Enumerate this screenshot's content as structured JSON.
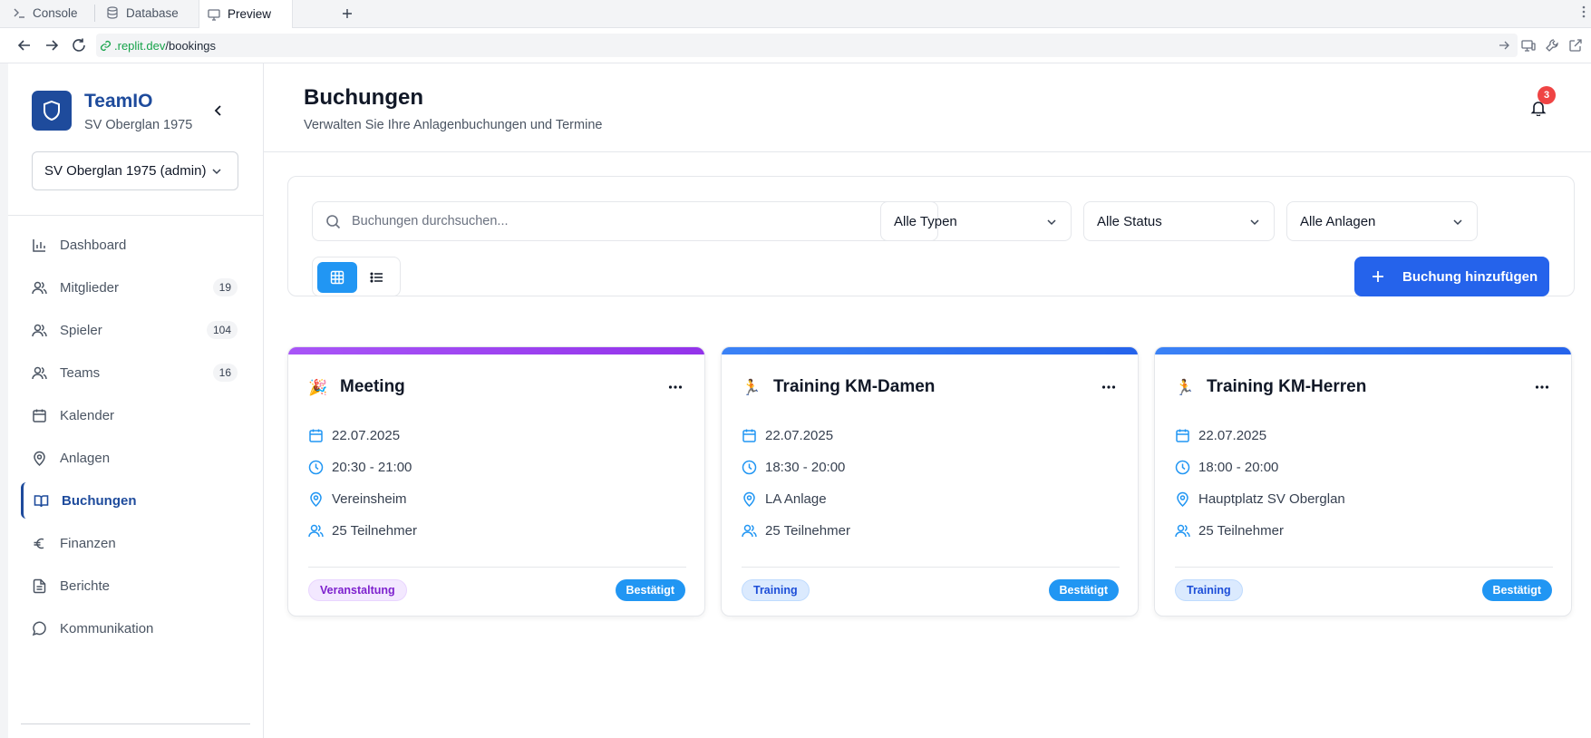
{
  "browser": {
    "tabs": [
      {
        "label": "Console",
        "icon": "terminal-icon"
      },
      {
        "label": "Database",
        "icon": "database-icon"
      },
      {
        "label": "Preview",
        "icon": "monitor-icon"
      }
    ],
    "url_host": ".replit.dev",
    "url_path": "/bookings"
  },
  "sidebar": {
    "brand_name": "TeamIO",
    "brand_sub": "SV Oberglan 1975",
    "club_select": "SV Oberglan 1975 (admin)",
    "items": [
      {
        "label": "Dashboard",
        "icon": "bar-chart-icon",
        "count": ""
      },
      {
        "label": "Mitglieder",
        "icon": "users-icon",
        "count": "19"
      },
      {
        "label": "Spieler",
        "icon": "users-icon",
        "count": "104"
      },
      {
        "label": "Teams",
        "icon": "users-icon",
        "count": "16"
      },
      {
        "label": "Kalender",
        "icon": "calendar-icon",
        "count": ""
      },
      {
        "label": "Anlagen",
        "icon": "map-pin-icon",
        "count": ""
      },
      {
        "label": "Buchungen",
        "icon": "book-open-icon",
        "count": "",
        "active": true
      },
      {
        "label": "Finanzen",
        "icon": "euro-icon",
        "count": ""
      },
      {
        "label": "Berichte",
        "icon": "file-text-icon",
        "count": ""
      },
      {
        "label": "Kommunikation",
        "icon": "message-icon",
        "count": ""
      }
    ]
  },
  "header": {
    "title": "Buchungen",
    "subtitle": "Verwalten Sie Ihre Anlagenbuchungen und Termine",
    "notifications_count": "3"
  },
  "filters": {
    "search_placeholder": "Buchungen durchsuchen...",
    "type_select": "Alle Typen",
    "status_select": "Alle Status",
    "facility_select": "Alle Anlagen",
    "add_button": "Buchung hinzufügen"
  },
  "colors": {
    "brand": "#1e4b9c",
    "accent": "#2196f3",
    "primary_button": "#2563eb",
    "event_bar": "#9333ea",
    "training_bar": "#2563eb",
    "badge_red": "#ef4444"
  },
  "bookings": [
    {
      "emoji": "🎉",
      "title": "Meeting",
      "date": "22.07.2025",
      "time": "20:30 - 21:00",
      "location": "Vereinsheim",
      "participants": "25 Teilnehmer",
      "type": "Veranstaltung",
      "status": "Bestätigt"
    },
    {
      "emoji": "🏃",
      "title": "Training KM-Damen",
      "date": "22.07.2025",
      "time": "18:30 - 20:00",
      "location": "LA Anlage",
      "participants": "25 Teilnehmer",
      "type": "Training",
      "status": "Bestätigt"
    },
    {
      "emoji": "🏃",
      "title": "Training KM-Herren",
      "date": "22.07.2025",
      "time": "18:00 - 20:00",
      "location": "Hauptplatz SV Oberglan",
      "participants": "25 Teilnehmer",
      "type": "Training",
      "status": "Bestätigt"
    }
  ]
}
